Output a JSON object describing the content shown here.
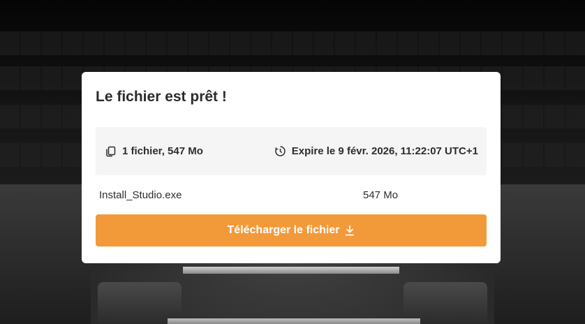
{
  "dialog": {
    "title": "Le fichier est prêt !",
    "file_count_summary": "1 fichier, 547 Mo",
    "expiry_text": "Expire le 9 févr. 2026, 11:22:07 UTC+1",
    "file": {
      "name": "Install_Studio.exe",
      "size": "547 Mo"
    },
    "download_button_label": "Télécharger le fichier",
    "accent_color": "#f29a3a"
  },
  "icons": {
    "files": "copy-files-icon",
    "expiry": "timer-icon",
    "download": "download-icon"
  }
}
